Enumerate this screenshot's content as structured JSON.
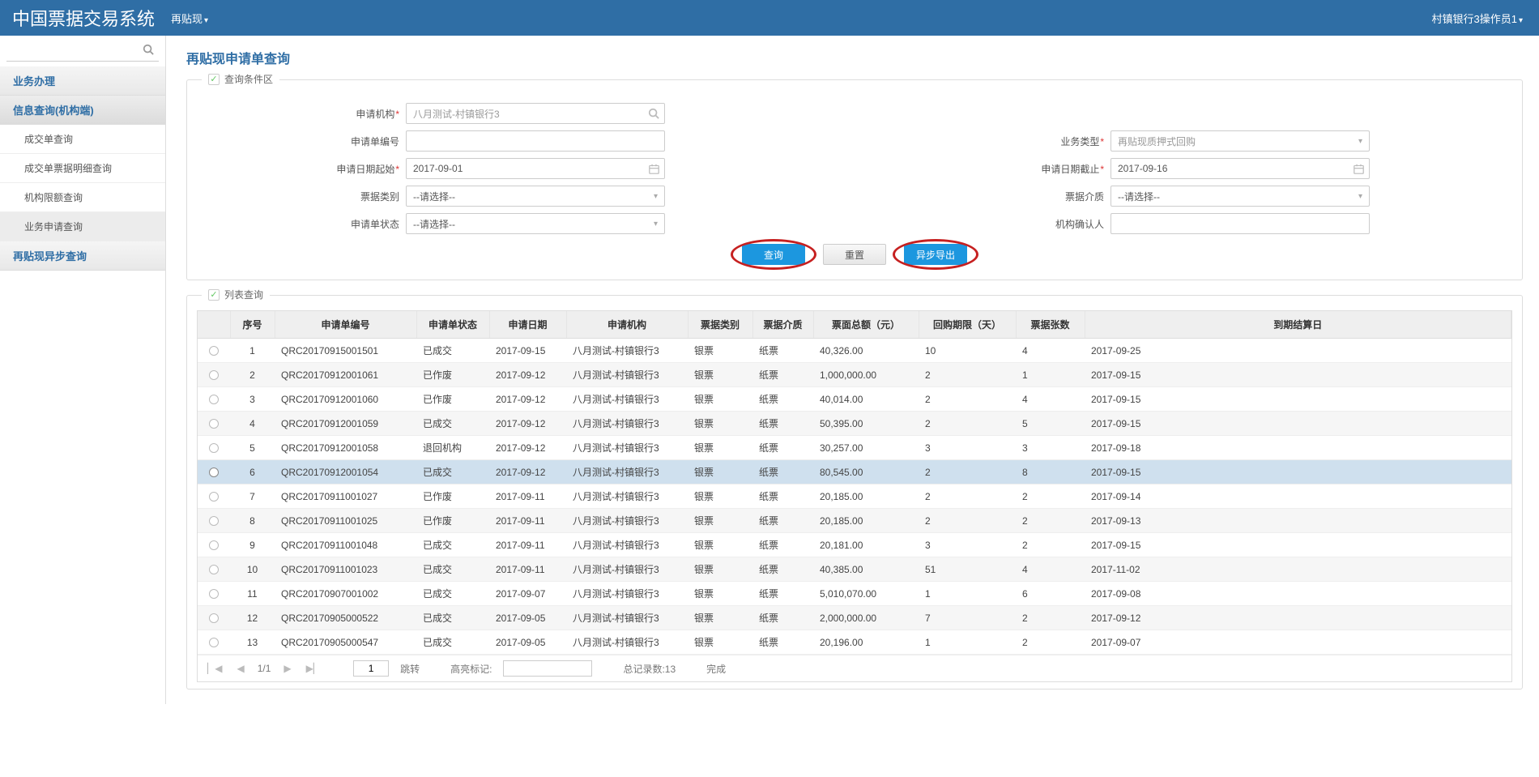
{
  "header": {
    "title": "中国票据交易系统",
    "nav_item": "再贴现",
    "user": "村镇银行3操作员1"
  },
  "sidebar": {
    "search_placeholder": "",
    "groups": [
      {
        "label": "业务办理",
        "active": false,
        "items": []
      },
      {
        "label": "信息查询(机构端)",
        "active": true,
        "items": [
          {
            "label": "成交单查询",
            "selected": false
          },
          {
            "label": "成交单票据明细查询",
            "selected": false
          },
          {
            "label": "机构限额查询",
            "selected": false
          },
          {
            "label": "业务申请查询",
            "selected": true
          }
        ]
      },
      {
        "label": "再贴现异步查询",
        "active": false,
        "items": []
      }
    ]
  },
  "page": {
    "title": "再贴现申请单查询"
  },
  "query_panel": {
    "legend": "查询条件区",
    "labels": {
      "apply_org": "申请机构",
      "apply_no": "申请单编号",
      "biz_type": "业务类型",
      "date_from": "申请日期起始",
      "date_to": "申请日期截止",
      "bill_class": "票据类别",
      "bill_medium": "票据介质",
      "apply_status": "申请单状态",
      "confirmer": "机构确认人"
    },
    "values": {
      "apply_org": "八月测试-村镇银行3",
      "apply_no": "",
      "biz_type": "再贴现质押式回购",
      "date_from": "2017-09-01",
      "date_to": "2017-09-16",
      "bill_class": "--请选择--",
      "bill_medium": "--请选择--",
      "apply_status": "--请选择--",
      "confirmer": ""
    },
    "buttons": {
      "query": "查询",
      "reset": "重置",
      "export": "异步导出"
    }
  },
  "list_panel": {
    "legend": "列表查询",
    "columns": [
      "",
      "序号",
      "申请单编号",
      "申请单状态",
      "申请日期",
      "申请机构",
      "票据类别",
      "票据介质",
      "票面总额（元）",
      "回购期限（天）",
      "票据张数",
      "到期结算日"
    ],
    "rows": [
      {
        "idx": "1",
        "no": "QRC20170915001501",
        "status": "已成交",
        "date": "2017-09-15",
        "org": "八月测试-村镇银行3",
        "cls": "银票",
        "med": "纸票",
        "amt": "40,326.00",
        "term": "10",
        "cnt": "4",
        "settle": "2017-09-25",
        "sel": false
      },
      {
        "idx": "2",
        "no": "QRC20170912001061",
        "status": "已作废",
        "date": "2017-09-12",
        "org": "八月测试-村镇银行3",
        "cls": "银票",
        "med": "纸票",
        "amt": "1,000,000.00",
        "term": "2",
        "cnt": "1",
        "settle": "2017-09-15",
        "sel": false
      },
      {
        "idx": "3",
        "no": "QRC20170912001060",
        "status": "已作废",
        "date": "2017-09-12",
        "org": "八月测试-村镇银行3",
        "cls": "银票",
        "med": "纸票",
        "amt": "40,014.00",
        "term": "2",
        "cnt": "4",
        "settle": "2017-09-15",
        "sel": false
      },
      {
        "idx": "4",
        "no": "QRC20170912001059",
        "status": "已成交",
        "date": "2017-09-12",
        "org": "八月测试-村镇银行3",
        "cls": "银票",
        "med": "纸票",
        "amt": "50,395.00",
        "term": "2",
        "cnt": "5",
        "settle": "2017-09-15",
        "sel": false
      },
      {
        "idx": "5",
        "no": "QRC20170912001058",
        "status": "退回机构",
        "date": "2017-09-12",
        "org": "八月测试-村镇银行3",
        "cls": "银票",
        "med": "纸票",
        "amt": "30,257.00",
        "term": "3",
        "cnt": "3",
        "settle": "2017-09-18",
        "sel": false
      },
      {
        "idx": "6",
        "no": "QRC20170912001054",
        "status": "已成交",
        "date": "2017-09-12",
        "org": "八月测试-村镇银行3",
        "cls": "银票",
        "med": "纸票",
        "amt": "80,545.00",
        "term": "2",
        "cnt": "8",
        "settle": "2017-09-15",
        "sel": true
      },
      {
        "idx": "7",
        "no": "QRC20170911001027",
        "status": "已作废",
        "date": "2017-09-11",
        "org": "八月测试-村镇银行3",
        "cls": "银票",
        "med": "纸票",
        "amt": "20,185.00",
        "term": "2",
        "cnt": "2",
        "settle": "2017-09-14",
        "sel": false
      },
      {
        "idx": "8",
        "no": "QRC20170911001025",
        "status": "已作废",
        "date": "2017-09-11",
        "org": "八月测试-村镇银行3",
        "cls": "银票",
        "med": "纸票",
        "amt": "20,185.00",
        "term": "2",
        "cnt": "2",
        "settle": "2017-09-13",
        "sel": false
      },
      {
        "idx": "9",
        "no": "QRC20170911001048",
        "status": "已成交",
        "date": "2017-09-11",
        "org": "八月测试-村镇银行3",
        "cls": "银票",
        "med": "纸票",
        "amt": "20,181.00",
        "term": "3",
        "cnt": "2",
        "settle": "2017-09-15",
        "sel": false
      },
      {
        "idx": "10",
        "no": "QRC20170911001023",
        "status": "已成交",
        "date": "2017-09-11",
        "org": "八月测试-村镇银行3",
        "cls": "银票",
        "med": "纸票",
        "amt": "40,385.00",
        "term": "51",
        "cnt": "4",
        "settle": "2017-11-02",
        "sel": false
      },
      {
        "idx": "11",
        "no": "QRC20170907001002",
        "status": "已成交",
        "date": "2017-09-07",
        "org": "八月测试-村镇银行3",
        "cls": "银票",
        "med": "纸票",
        "amt": "5,010,070.00",
        "term": "1",
        "cnt": "6",
        "settle": "2017-09-08",
        "sel": false
      },
      {
        "idx": "12",
        "no": "QRC20170905000522",
        "status": "已成交",
        "date": "2017-09-05",
        "org": "八月测试-村镇银行3",
        "cls": "银票",
        "med": "纸票",
        "amt": "2,000,000.00",
        "term": "7",
        "cnt": "2",
        "settle": "2017-09-12",
        "sel": false
      },
      {
        "idx": "13",
        "no": "QRC20170905000547",
        "status": "已成交",
        "date": "2017-09-05",
        "org": "八月测试-村镇银行3",
        "cls": "银票",
        "med": "纸票",
        "amt": "20,196.00",
        "term": "1",
        "cnt": "2",
        "settle": "2017-09-07",
        "sel": false
      }
    ]
  },
  "pager": {
    "page_of": "1/1",
    "page_input": "1",
    "jump": "跳转",
    "highlight": "高亮标记:",
    "total": "总记录数:13",
    "status": "完成"
  }
}
